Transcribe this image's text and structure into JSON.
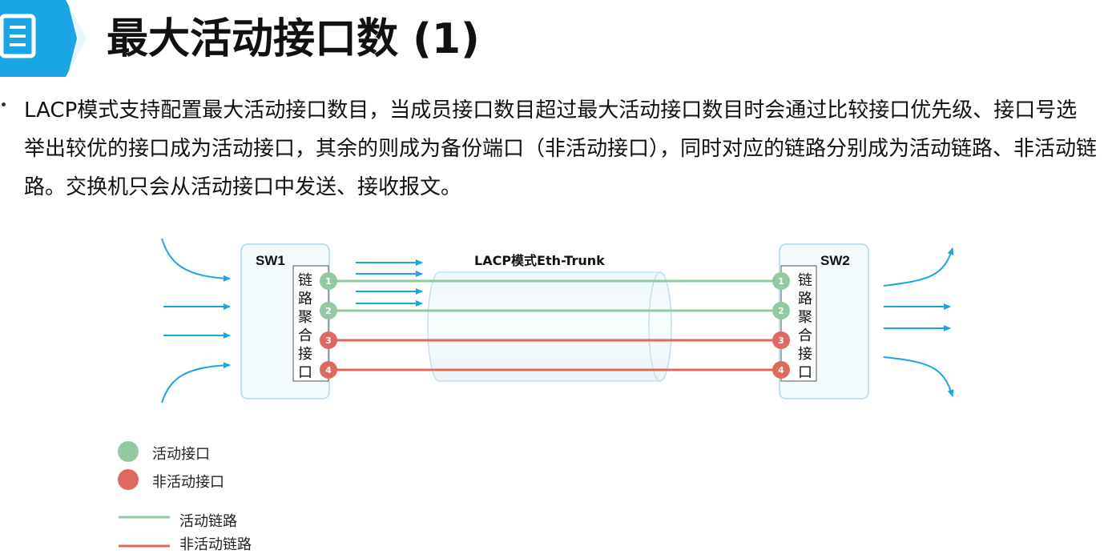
{
  "title": "最大活动接口数 (1)",
  "bullet_text": "LACP模式支持配置最大活动接口数目，当成员接口数目超过最大活动接口数目时会通过比较接口优先级、接口号选举出较优的接口成为活动接口，其余的则成为备份端口（非活动接口），同时对应的链路分别成为活动链路、非活动链路。交换机只会从活动接口中发送、接收报文。",
  "diagram": {
    "trunk_label": "LACP模式Eth-Trunk",
    "sw1_label": "SW1",
    "sw2_label": "SW2",
    "agg_label_chars": [
      "链",
      "路",
      "聚",
      "合",
      "接",
      "口"
    ],
    "ports": [
      {
        "num": "1",
        "state": "active"
      },
      {
        "num": "2",
        "state": "active"
      },
      {
        "num": "3",
        "state": "inactive"
      },
      {
        "num": "4",
        "state": "inactive"
      }
    ]
  },
  "legend": {
    "active_port": "活动接口",
    "inactive_port": "非活动接口",
    "active_link": "活动链路",
    "inactive_link": "非活动链路"
  },
  "colors": {
    "active": "#93c9a1",
    "inactive": "#e0695f",
    "arrow": "#1aa6e4",
    "switch_border": "#a9dcef",
    "icon": "#1aa6e4"
  }
}
